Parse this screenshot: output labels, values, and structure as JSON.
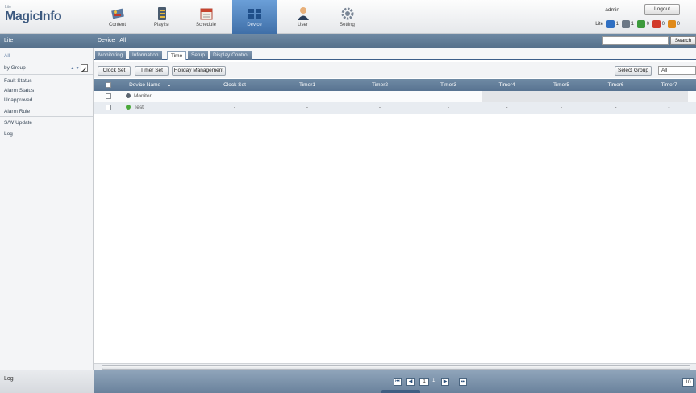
{
  "app": {
    "lite_label": "Lite",
    "brand": "MagicInfo"
  },
  "nav": [
    {
      "label": "Content",
      "icon": "content-icon"
    },
    {
      "label": "Playlist",
      "icon": "playlist-icon"
    },
    {
      "label": "Schedule",
      "icon": "schedule-icon"
    },
    {
      "label": "Device",
      "icon": "device-icon",
      "active": true
    },
    {
      "label": "User",
      "icon": "user-icon"
    },
    {
      "label": "Setting",
      "icon": "setting-icon"
    }
  ],
  "user": {
    "name": "admin",
    "logout_label": "Logout",
    "mode_label": "Lite",
    "counts": [
      {
        "icon": "device-total-icon",
        "color": "#2f6fc2",
        "value": "1"
      },
      {
        "icon": "device-connected-icon",
        "color": "#6b7785",
        "value": "1"
      },
      {
        "icon": "device-ok-icon",
        "color": "#3c9a3c",
        "value": "0"
      },
      {
        "icon": "device-error-icon",
        "color": "#d23a2a",
        "value": "0"
      },
      {
        "icon": "device-warning-icon",
        "color": "#e08a1a",
        "value": "0"
      }
    ]
  },
  "sidebar": {
    "header": "Lite",
    "all_label": "All",
    "group_label": "by Group",
    "group_arrows": "▲ ▼",
    "items": [
      "Fault Status",
      "Alarm Status",
      "Unapproved",
      "Alarm Rule",
      "S/W Update",
      "Log"
    ],
    "footer": "Log"
  },
  "main": {
    "breadcrumb_device": "Device",
    "breadcrumb_all": "All",
    "search_placeholder": "",
    "search_label": "Search",
    "tabs": [
      "Monitoring",
      "Information",
      "Time",
      "Setup",
      "Display Control"
    ],
    "active_tab": "Time",
    "toolbar": {
      "clock_set": "Clock Set",
      "timer_set": "Timer Set",
      "holiday_management": "Holiday Management",
      "select_group": "Select Group",
      "group_value": "All"
    },
    "columns": [
      "Device Name",
      "Clock Set",
      "Timer1",
      "Timer2",
      "Timer3",
      "Timer4",
      "Timer5",
      "Timer6",
      "Timer7"
    ],
    "sort_indicator": "▲",
    "rows": [
      {
        "name": "Monitor",
        "status_color": "#5b6570",
        "clock": "",
        "timers": [
          "",
          "",
          "",
          "",
          "",
          "",
          ""
        ]
      },
      {
        "name": "Test",
        "status_color": "#4aa83a",
        "clock": "-",
        "timers": [
          "-",
          "-",
          "-",
          "-",
          "-",
          "-",
          "-"
        ]
      }
    ],
    "pager": {
      "first": "⏮",
      "prev": "◀",
      "current_page": "1",
      "total_pages": "1",
      "next": "▶",
      "last": "⏭",
      "page_size": "10"
    }
  }
}
